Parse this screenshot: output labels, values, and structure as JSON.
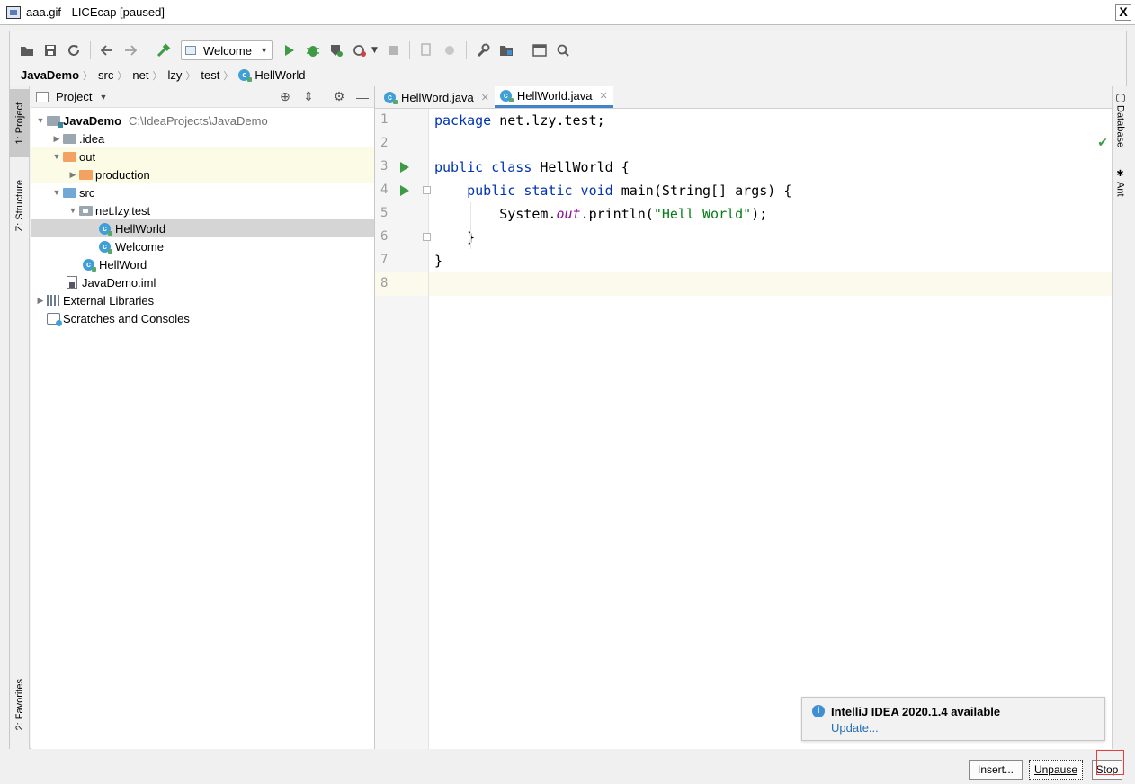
{
  "window": {
    "title": "aaa.gif - LICEcap [paused]",
    "close_label": "X"
  },
  "toolbar": {
    "run_config": "Welcome"
  },
  "breadcrumb": [
    "JavaDemo",
    "src",
    "net",
    "lzy",
    "test",
    "HellWorld"
  ],
  "left_stripe": {
    "project_tab": "1: Project",
    "structure_tab": "Z: Structure",
    "favorites_tab": "2: Favorites"
  },
  "right_stripe": {
    "database_tab": "Database",
    "ant_tab": "Ant"
  },
  "project_panel": {
    "title": "Project",
    "tree": {
      "root": {
        "name": "JavaDemo",
        "path": "C:\\IdeaProjects\\JavaDemo"
      },
      "idea": ".idea",
      "out": "out",
      "production": "production",
      "src": "src",
      "package": "net.lzy.test",
      "class_hellworld": "HellWorld",
      "class_welcome": "Welcome",
      "class_hellword": "HellWord",
      "iml": "JavaDemo.iml",
      "external_libraries": "External Libraries",
      "scratches": "Scratches and Consoles"
    }
  },
  "editor": {
    "tabs": [
      {
        "label": "HellWord.java",
        "active": false
      },
      {
        "label": "HellWorld.java",
        "active": true
      }
    ],
    "line_numbers": [
      "1",
      "2",
      "3",
      "4",
      "5",
      "6",
      "7",
      "8"
    ],
    "code": {
      "l1_kw": "package",
      "l1_rest": " net.lzy.test;",
      "l3_kw": "public class",
      "l3_rest": " HellWorld {",
      "l4_indent": "    ",
      "l4_kw": "public static void",
      "l4_rest": " main(String[] args) {",
      "l5_indent": "        ",
      "l5_a": "System.",
      "l5_field": "out",
      "l5_b": ".println(",
      "l5_str": "\"Hell World\"",
      "l5_c": ");",
      "l6": "    }",
      "l7": "}"
    }
  },
  "notification": {
    "title": "IntelliJ IDEA 2020.1.4 available",
    "link": "Update..."
  },
  "licecap": {
    "insert": "Insert...",
    "unpause": "Unpause",
    "stop": "Stop"
  }
}
